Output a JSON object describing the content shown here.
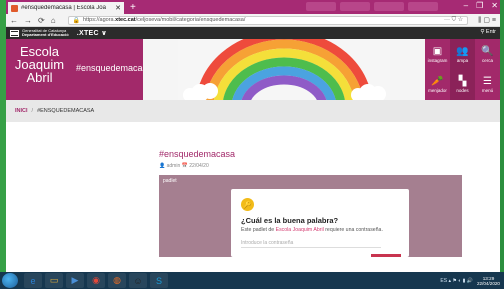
{
  "browser": {
    "tab_title": "#ensquedemacasa | Escola Joa",
    "tab_close": "✕",
    "new_tab": "+",
    "window_controls": [
      "–",
      "❐",
      "✕"
    ],
    "url_prefix": "https://agora.",
    "url_domain": "xtec.cat",
    "url_suffix": "/celjoseva/mobil/categoria/ensquedemacasa/",
    "url_icons": "··· ⛉ ☆",
    "right_icons": "⫼ ▢ ≡"
  },
  "xtec_bar": {
    "gencat_line1": "Generalitat de Catalunya",
    "gencat_line2": "Departament d'Educació",
    "brand": ".XTEC ∨",
    "right": "⚲ Entr"
  },
  "header": {
    "school_name": "Escola Joaquim Abril",
    "hashtag": "#ensquedemacasa",
    "grid": [
      {
        "label": "instagram",
        "icon": "▣",
        "color": "#a2296a",
        "icon_name": "instagram-icon"
      },
      {
        "label": "ampa",
        "icon": "👥",
        "color": "#8b2259",
        "icon_name": "group-icon"
      },
      {
        "label": "cerca",
        "icon": "🔍",
        "color": "#a2296a",
        "icon_name": "search-icon"
      },
      {
        "label": "menjador",
        "icon": "🥕",
        "color": "#a2296a",
        "icon_name": "carrot-icon"
      },
      {
        "label": "nodes",
        "icon": "▚",
        "color": "#8b2259",
        "icon_name": "nodes-icon"
      },
      {
        "label": "menú",
        "icon": "☰",
        "color": "#a2296a",
        "icon_name": "menu-icon"
      }
    ]
  },
  "breadcrumb": {
    "home": "INICI",
    "separator": "/",
    "current": "#ENSQUEDEMACASA"
  },
  "post": {
    "title": "#ensquedemacasa",
    "author": "admin",
    "date": "22/04/20"
  },
  "padlet": {
    "label": "padlet",
    "key_icon": "🔑",
    "title": "¿Cuál es la buena palabra?",
    "text_before": "Este padlet de ",
    "text_link": "Escola Joaquim Abril",
    "text_after": " requiere una contraseña.",
    "password_placeholder": "Introduce la contraseña"
  },
  "taskbar": {
    "items": [
      {
        "icon": "e",
        "color": "#2c7fd0",
        "name": "ie-icon"
      },
      {
        "icon": "▭",
        "color": "#e0b040",
        "name": "explorer-icon"
      },
      {
        "icon": "▶",
        "color": "#4a8fd6",
        "name": "media-icon"
      },
      {
        "icon": "◉",
        "color": "#e4493a",
        "name": "chrome-icon"
      },
      {
        "icon": "◍",
        "color": "#e36b25",
        "name": "firefox-icon"
      },
      {
        "icon": "☺",
        "color": "#222222",
        "name": "app-icon"
      },
      {
        "icon": "S",
        "color": "#1a9bd7",
        "name": "skype-icon"
      }
    ],
    "tray_icons": "ES ▴ ⚑ ◐ ▮ 🔊",
    "time": "13:29",
    "date": "22/04/2020"
  },
  "colors": {
    "accent": "#a2296a",
    "accent_dark": "#8b2259",
    "padlet_bg": "#a57f90",
    "key_yellow": "#f2bb18",
    "taskbar": "#16374f"
  }
}
